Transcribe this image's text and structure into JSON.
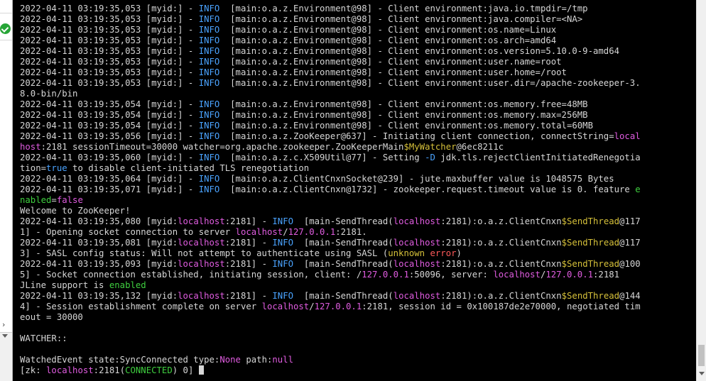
{
  "sidebar": {
    "status_icon": "check-circle-icon",
    "status_color": "#27a537",
    "chevron": "›"
  },
  "colors": {
    "background": "#000000",
    "text": "#d6d6d6",
    "info": "#4aa3ff",
    "highlight": "#e05ce0",
    "class": "#d6c13a",
    "success": "#3fcf3f",
    "error": "#ff5a5a"
  },
  "terminal": {
    "lines": [
      [
        [
          "2022-04-11 03:19:35,053 [myid:] - ",
          ""
        ],
        [
          "INFO",
          "b"
        ],
        [
          "  [main:o.a.z.Environment@98] - Client environment:java.io.tmpdir=/tmp",
          ""
        ]
      ],
      [
        [
          "2022-04-11 03:19:35,053 [myid:] - ",
          ""
        ],
        [
          "INFO",
          "b"
        ],
        [
          "  [main:o.a.z.Environment@98] - Client environment:java.compiler=<NA>",
          ""
        ]
      ],
      [
        [
          "2022-04-11 03:19:35,053 [myid:] - ",
          ""
        ],
        [
          "INFO",
          "b"
        ],
        [
          "  [main:o.a.z.Environment@98] - Client environment:os.name=Linux",
          ""
        ]
      ],
      [
        [
          "2022-04-11 03:19:35,053 [myid:] - ",
          ""
        ],
        [
          "INFO",
          "b"
        ],
        [
          "  [main:o.a.z.Environment@98] - Client environment:os.arch=amd64",
          ""
        ]
      ],
      [
        [
          "2022-04-11 03:19:35,053 [myid:] - ",
          ""
        ],
        [
          "INFO",
          "b"
        ],
        [
          "  [main:o.a.z.Environment@98] - Client environment:os.version=5.10.0-9-amd64",
          ""
        ]
      ],
      [
        [
          "2022-04-11 03:19:35,053 [myid:] - ",
          ""
        ],
        [
          "INFO",
          "b"
        ],
        [
          "  [main:o.a.z.Environment@98] - Client environment:user.name=root",
          ""
        ]
      ],
      [
        [
          "2022-04-11 03:19:35,053 [myid:] - ",
          ""
        ],
        [
          "INFO",
          "b"
        ],
        [
          "  [main:o.a.z.Environment@98] - Client environment:user.home=/root",
          ""
        ]
      ],
      [
        [
          "2022-04-11 03:19:35,053 [myid:] - ",
          ""
        ],
        [
          "INFO",
          "b"
        ],
        [
          "  [main:o.a.z.Environment@98] - Client environment:user.dir=/apache-zookeeper-3.",
          ""
        ]
      ],
      [
        [
          "8.0-bin/bin",
          ""
        ]
      ],
      [
        [
          "2022-04-11 03:19:35,054 [myid:] - ",
          ""
        ],
        [
          "INFO",
          "b"
        ],
        [
          "  [main:o.a.z.Environment@98] - Client environment:os.memory.free=48MB",
          ""
        ]
      ],
      [
        [
          "2022-04-11 03:19:35,054 [myid:] - ",
          ""
        ],
        [
          "INFO",
          "b"
        ],
        [
          "  [main:o.a.z.Environment@98] - Client environment:os.memory.max=256MB",
          ""
        ]
      ],
      [
        [
          "2022-04-11 03:19:35,054 [myid:] - ",
          ""
        ],
        [
          "INFO",
          "b"
        ],
        [
          "  [main:o.a.z.Environment@98] - Client environment:os.memory.total=60MB",
          ""
        ]
      ],
      [
        [
          "2022-04-11 03:19:35,056 [myid:] - ",
          ""
        ],
        [
          "INFO",
          "b"
        ],
        [
          "  [main:o.a.z.ZooKeeper@637] - Initiating client connection, connectString=",
          ""
        ],
        [
          "local",
          "m"
        ]
      ],
      [
        [
          "host",
          "m"
        ],
        [
          ":2181 sessionTimeout=30000 watcher=org.apache.zookeeper.ZooKeeperMain",
          ""
        ],
        [
          "$MyWatcher",
          "y"
        ],
        [
          "@6ec8211c",
          ""
        ]
      ],
      [
        [
          "2022-04-11 03:19:35,060 [myid:] - ",
          ""
        ],
        [
          "INFO",
          "b"
        ],
        [
          "  [main:o.a.z.c.X509Util@77] - Setting ",
          ""
        ],
        [
          "-D",
          "b"
        ],
        [
          " jdk.tls.rejectClientInitiatedRenegotia",
          ""
        ]
      ],
      [
        [
          "tion=",
          ""
        ],
        [
          "true",
          "b"
        ],
        [
          " to disable client-initiated TLS renegotiation",
          ""
        ]
      ],
      [
        [
          "2022-04-11 03:19:35,064 [myid:] - ",
          ""
        ],
        [
          "INFO",
          "b"
        ],
        [
          "  [main:o.a.z.ClientCnxnSocket@239] - jute.maxbuffer value is 1048575 Bytes",
          ""
        ]
      ],
      [
        [
          "2022-04-11 03:19:35,071 [myid:] - ",
          ""
        ],
        [
          "INFO",
          "b"
        ],
        [
          "  [main:o.a.z.ClientCnxn@1732] - zookeeper.request.timeout value is 0. feature ",
          ""
        ],
        [
          "e",
          "g"
        ]
      ],
      [
        [
          "nabled",
          "g"
        ],
        [
          "=",
          ""
        ],
        [
          "false",
          "m"
        ]
      ],
      [
        [
          "Welcome to ZooKeeper!",
          ""
        ]
      ],
      [
        [
          "2022-04-11 03:19:35,080 [myid:",
          ""
        ],
        [
          "localhost",
          "m"
        ],
        [
          ":2181] - ",
          ""
        ],
        [
          "INFO",
          "b"
        ],
        [
          "  [main-SendThread(",
          ""
        ],
        [
          "localhost",
          "m"
        ],
        [
          ":2181):o.a.z.ClientCnxn",
          ""
        ],
        [
          "$SendThread",
          "y"
        ],
        [
          "@117",
          ""
        ]
      ],
      [
        [
          "1] - Opening socket connection to server ",
          ""
        ],
        [
          "localhost",
          "m"
        ],
        [
          "/",
          ""
        ],
        [
          "127.0.0.1",
          "m"
        ],
        [
          ":2181.",
          ""
        ]
      ],
      [
        [
          "2022-04-11 03:19:35,081 [myid:",
          ""
        ],
        [
          "localhost",
          "m"
        ],
        [
          ":2181] - ",
          ""
        ],
        [
          "INFO",
          "b"
        ],
        [
          "  [main-SendThread(",
          ""
        ],
        [
          "localhost",
          "m"
        ],
        [
          ":2181):o.a.z.ClientCnxn",
          ""
        ],
        [
          "$SendThread",
          "y"
        ],
        [
          "@117",
          ""
        ]
      ],
      [
        [
          "3] - SASL config status: Will not attempt to authenticate using SASL (",
          ""
        ],
        [
          "unknown",
          "y"
        ],
        [
          " ",
          ""
        ],
        [
          "error",
          "r"
        ],
        [
          ")",
          ""
        ]
      ],
      [
        [
          "2022-04-11 03:19:35,093 [myid:",
          ""
        ],
        [
          "localhost",
          "m"
        ],
        [
          ":2181] - ",
          ""
        ],
        [
          "INFO",
          "b"
        ],
        [
          "  [main-SendThread(",
          ""
        ],
        [
          "localhost",
          "m"
        ],
        [
          ":2181):o.a.z.ClientCnxn",
          ""
        ],
        [
          "$SendThread",
          "y"
        ],
        [
          "@100",
          ""
        ]
      ],
      [
        [
          "5] - Socket connection established, initiating session, client: /",
          ""
        ],
        [
          "127.0.0.1",
          "m"
        ],
        [
          ":50096, server: ",
          ""
        ],
        [
          "localhost",
          "m"
        ],
        [
          "/",
          ""
        ],
        [
          "127.0.0.1",
          "m"
        ],
        [
          ":2181",
          ""
        ]
      ],
      [
        [
          "JLine support is ",
          ""
        ],
        [
          "enabled",
          "g"
        ]
      ],
      [
        [
          "2022-04-11 03:19:35,132 [myid:",
          ""
        ],
        [
          "localhost",
          "m"
        ],
        [
          ":2181] - ",
          ""
        ],
        [
          "INFO",
          "b"
        ],
        [
          "  [main-SendThread(",
          ""
        ],
        [
          "localhost",
          "m"
        ],
        [
          ":2181):o.a.z.ClientCnxn",
          ""
        ],
        [
          "$SendThread",
          "y"
        ],
        [
          "@144",
          ""
        ]
      ],
      [
        [
          "4] - Session establishment complete on server ",
          ""
        ],
        [
          "localhost",
          "m"
        ],
        [
          "/",
          ""
        ],
        [
          "127.0.0.1",
          "m"
        ],
        [
          ":2181, session id = 0x100187de2e70000, negotiated tim",
          ""
        ]
      ],
      [
        [
          "eout = 30000",
          ""
        ]
      ],
      [
        [
          "",
          ""
        ]
      ],
      [
        [
          "WATCHER::",
          ""
        ]
      ],
      [
        [
          "",
          ""
        ]
      ],
      [
        [
          "WatchedEvent state:SyncConnected type:",
          ""
        ],
        [
          "None",
          "m"
        ],
        [
          " path:",
          ""
        ],
        [
          "null",
          "m"
        ]
      ],
      [
        [
          "[zk: ",
          ""
        ],
        [
          "localhost",
          "m"
        ],
        [
          ":2181(",
          ""
        ],
        [
          "CONNECTED",
          "g"
        ],
        [
          ") 0] ",
          ""
        ]
      ]
    ]
  }
}
